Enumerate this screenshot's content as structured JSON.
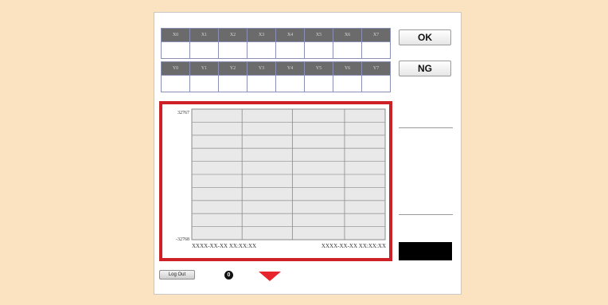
{
  "x_row": {
    "labels": [
      "X0",
      "X1",
      "X2",
      "X3",
      "X4",
      "X5",
      "X6",
      "X7"
    ],
    "values": [
      "",
      "",
      "",
      "",
      "",
      "",
      "",
      ""
    ]
  },
  "y_row": {
    "labels": [
      "Y0",
      "Y1",
      "Y2",
      "Y3",
      "Y4",
      "Y5",
      "Y6",
      "Y7"
    ],
    "values": [
      "",
      "",
      "",
      "",
      "",
      "",
      "",
      ""
    ]
  },
  "buttons": {
    "ok": "OK",
    "ng": "NG"
  },
  "chart_data": {
    "type": "line",
    "ylim": [
      -32768,
      32767
    ],
    "y_max_label": "32767",
    "y_min_label": "-32768",
    "x_start_label": "XXXX-XX-XX XX:XX:XX",
    "x_end_label": "XXXX-XX-XX XX:XX:XX",
    "grid": true,
    "highlight_color": "#cd2027",
    "series": []
  },
  "footer": {
    "logout_label": "Log Out",
    "count_badge": "0",
    "arrow_color": "#e8242c",
    "arrow_icon": "triangle-down-icon"
  }
}
